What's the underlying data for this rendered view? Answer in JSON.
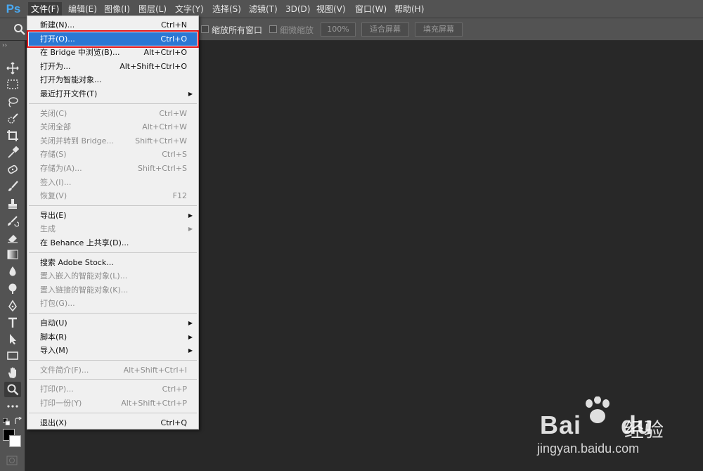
{
  "app": {
    "logo": "Ps"
  },
  "menubar": {
    "items": [
      {
        "label": "文件(F)",
        "active": true
      },
      {
        "label": "编辑(E)"
      },
      {
        "label": "图像(I)"
      },
      {
        "label": "图层(L)"
      },
      {
        "label": "文字(Y)"
      },
      {
        "label": "选择(S)"
      },
      {
        "label": "滤镜(T)"
      },
      {
        "label": "3D(D)"
      },
      {
        "label": "视图(V)"
      },
      {
        "label": "窗口(W)"
      },
      {
        "label": "帮助(H)"
      }
    ]
  },
  "options": {
    "tool_icon": "zoom-icon",
    "zoom_all_windows": "缩放所有窗口",
    "scrubby_zoom": "细微缩放",
    "zoom_percent": "100%",
    "fit_screen": "适合屏幕",
    "fill_screen": "填充屏幕"
  },
  "toolbar": {
    "grip": "››",
    "tools": [
      "move-icon",
      "marquee-icon",
      "lasso-icon",
      "quick-selection-icon",
      "crop-icon",
      "eyedropper-icon",
      "healing-brush-icon",
      "brush-icon",
      "clone-stamp-icon",
      "history-brush-icon",
      "eraser-icon",
      "gradient-icon",
      "blur-icon",
      "dodge-icon",
      "pen-icon",
      "type-icon",
      "path-selection-icon",
      "rectangle-icon",
      "hand-icon",
      "zoom-icon",
      "more-tools-icon"
    ],
    "active_tool": "zoom-icon"
  },
  "file_menu": {
    "groups": [
      [
        {
          "label": "新建(N)...",
          "shortcut": "Ctrl+N"
        },
        {
          "label": "打开(O)...",
          "shortcut": "Ctrl+O",
          "selected": true
        },
        {
          "label": "在 Bridge 中浏览(B)...",
          "shortcut": "Alt+Ctrl+O"
        },
        {
          "label": "打开为...",
          "shortcut": "Alt+Shift+Ctrl+O"
        },
        {
          "label": "打开为智能对象..."
        },
        {
          "label": "最近打开文件(T)",
          "submenu": true
        }
      ],
      [
        {
          "label": "关闭(C)",
          "shortcut": "Ctrl+W",
          "disabled": true
        },
        {
          "label": "关闭全部",
          "shortcut": "Alt+Ctrl+W",
          "disabled": true
        },
        {
          "label": "关闭并转到 Bridge...",
          "shortcut": "Shift+Ctrl+W",
          "disabled": true
        },
        {
          "label": "存储(S)",
          "shortcut": "Ctrl+S",
          "disabled": true
        },
        {
          "label": "存储为(A)...",
          "shortcut": "Shift+Ctrl+S",
          "disabled": true
        },
        {
          "label": "签入(I)...",
          "disabled": true
        },
        {
          "label": "恢复(V)",
          "shortcut": "F12",
          "disabled": true
        }
      ],
      [
        {
          "label": "导出(E)",
          "submenu": true
        },
        {
          "label": "生成",
          "submenu": true,
          "disabled": true
        },
        {
          "label": "在 Behance 上共享(D)..."
        }
      ],
      [
        {
          "label": "搜索 Adobe Stock..."
        },
        {
          "label": "置入嵌入的智能对象(L)...",
          "disabled": true
        },
        {
          "label": "置入链接的智能对象(K)...",
          "disabled": true
        },
        {
          "label": "打包(G)...",
          "disabled": true
        }
      ],
      [
        {
          "label": "自动(U)",
          "submenu": true
        },
        {
          "label": "脚本(R)",
          "submenu": true
        },
        {
          "label": "导入(M)",
          "submenu": true
        }
      ],
      [
        {
          "label": "文件简介(F)...",
          "shortcut": "Alt+Shift+Ctrl+I",
          "disabled": true
        }
      ],
      [
        {
          "label": "打印(P)...",
          "shortcut": "Ctrl+P",
          "disabled": true
        },
        {
          "label": "打印一份(Y)",
          "shortcut": "Alt+Shift+Ctrl+P",
          "disabled": true
        }
      ],
      [
        {
          "label": "退出(X)",
          "shortcut": "Ctrl+Q"
        }
      ]
    ]
  },
  "watermark": {
    "brand": "Bai",
    "brand_suffix": "du",
    "brand_cn": "经验",
    "url": "jingyan.baidu.com"
  }
}
